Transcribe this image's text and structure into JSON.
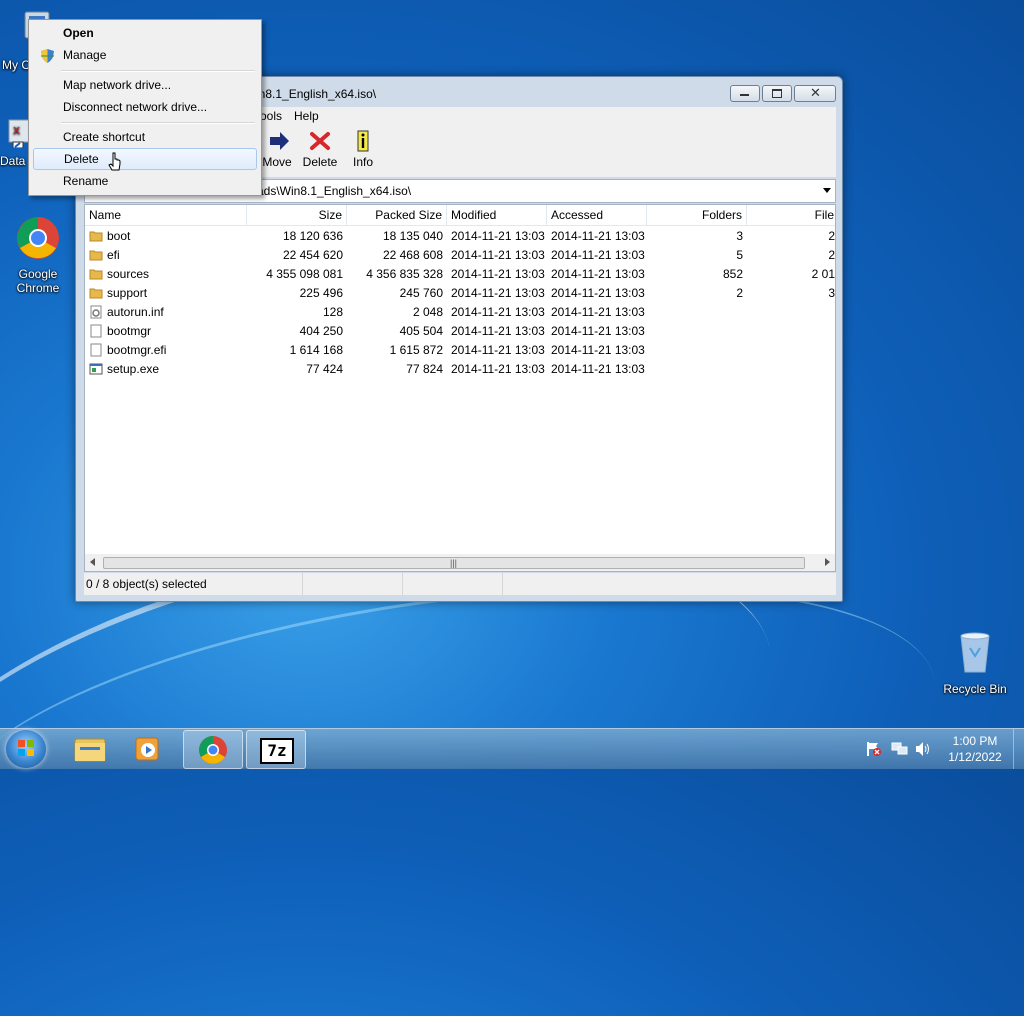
{
  "desktop": {
    "icons": [
      {
        "label": "My C"
      },
      {
        "label": "Data"
      },
      {
        "label": "Google Chrome"
      },
      {
        "label": "Recycle Bin"
      }
    ]
  },
  "window": {
    "title": "in8.1_English_x64.iso\\",
    "menu": [
      "ools",
      "Help"
    ],
    "toolbar": {
      "move": "Move",
      "delete": "Delete",
      "info": "Info"
    },
    "address": "ads\\Win8.1_English_x64.iso\\",
    "columns": [
      "Name",
      "Size",
      "Packed Size",
      "Modified",
      "Accessed",
      "Folders",
      "File"
    ],
    "rows": [
      {
        "name": "boot",
        "type": "folder",
        "size": "18 120 636",
        "packed": "18 135 040",
        "modified": "2014-11-21 13:03",
        "accessed": "2014-11-21 13:03",
        "folders": "3",
        "files": "2"
      },
      {
        "name": "efi",
        "type": "folder",
        "size": "22 454 620",
        "packed": "22 468 608",
        "modified": "2014-11-21 13:03",
        "accessed": "2014-11-21 13:03",
        "folders": "5",
        "files": "2"
      },
      {
        "name": "sources",
        "type": "folder",
        "size": "4 355 098 081",
        "packed": "4 356 835 328",
        "modified": "2014-11-21 13:03",
        "accessed": "2014-11-21 13:03",
        "folders": "852",
        "files": "2 01"
      },
      {
        "name": "support",
        "type": "folder",
        "size": "225 496",
        "packed": "245 760",
        "modified": "2014-11-21 13:03",
        "accessed": "2014-11-21 13:03",
        "folders": "2",
        "files": "3"
      },
      {
        "name": "autorun.inf",
        "type": "inf",
        "size": "128",
        "packed": "2 048",
        "modified": "2014-11-21 13:03",
        "accessed": "2014-11-21 13:03",
        "folders": "",
        "files": ""
      },
      {
        "name": "bootmgr",
        "type": "file",
        "size": "404 250",
        "packed": "405 504",
        "modified": "2014-11-21 13:03",
        "accessed": "2014-11-21 13:03",
        "folders": "",
        "files": ""
      },
      {
        "name": "bootmgr.efi",
        "type": "file",
        "size": "1 614 168",
        "packed": "1 615 872",
        "modified": "2014-11-21 13:03",
        "accessed": "2014-11-21 13:03",
        "folders": "",
        "files": ""
      },
      {
        "name": "setup.exe",
        "type": "exe",
        "size": "77 424",
        "packed": "77 824",
        "modified": "2014-11-21 13:03",
        "accessed": "2014-11-21 13:03",
        "folders": "",
        "files": ""
      }
    ],
    "status": "0 / 8 object(s) selected",
    "scroll_grip": "|||"
  },
  "context_menu": {
    "items": [
      "Open",
      "Manage",
      "Map network drive...",
      "Disconnect network drive...",
      "Create shortcut",
      "Delete",
      "Rename"
    ],
    "highlighted": "Delete"
  },
  "taskbar": {
    "apps": [
      "explorer",
      "media-player",
      "chrome",
      "7zip"
    ],
    "sevenzip_label": "7z",
    "time": "1:00 PM",
    "date": "1/12/2022"
  },
  "colors": {
    "accent": "#1a78d0",
    "delete_red": "#d9262a",
    "folder": "#e8b84a"
  }
}
